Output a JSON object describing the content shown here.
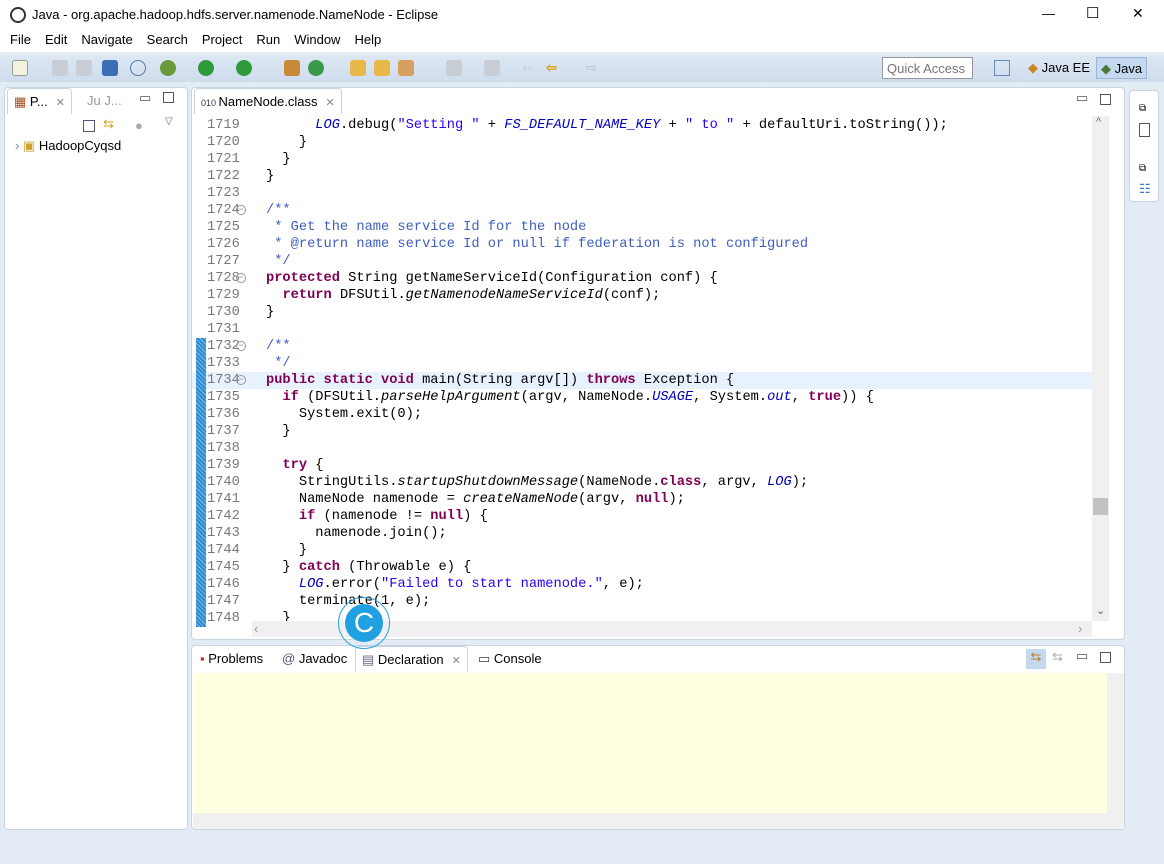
{
  "window": {
    "title": "Java - org.apache.hadoop.hdfs.server.namenode.NameNode - Eclipse",
    "minimize": "—",
    "maximize": "☐",
    "close": "✕"
  },
  "menu": [
    "File",
    "Edit",
    "Navigate",
    "Search",
    "Project",
    "Run",
    "Window",
    "Help"
  ],
  "toolbar": {
    "quick_access_placeholder": "Quick Access",
    "perspectives": [
      {
        "label": "Java EE"
      },
      {
        "label": "Java",
        "active": true
      }
    ]
  },
  "left_panel": {
    "tabs": [
      {
        "label": "P...",
        "active": true
      },
      {
        "label": "J..."
      }
    ],
    "tree": [
      {
        "label": "HadoopCyqsd"
      }
    ]
  },
  "editor": {
    "tab": "NameNode.class",
    "current_line": 1734,
    "lines": [
      {
        "n": "1719",
        "t": [
          [
            "p",
            "      "
          ],
          [
            "sf",
            "LOG"
          ],
          [
            "p",
            ".debug("
          ],
          [
            "s",
            "\"Setting \""
          ],
          [
            "p",
            " + "
          ],
          [
            "sf",
            "FS_DEFAULT_NAME_KEY"
          ],
          [
            "p",
            " + "
          ],
          [
            "s",
            "\" to \""
          ],
          [
            "p",
            " + defaultUri.toString());"
          ]
        ]
      },
      {
        "n": "1720",
        "t": [
          [
            "p",
            "    }"
          ]
        ]
      },
      {
        "n": "1721",
        "t": [
          [
            "p",
            "  }"
          ]
        ]
      },
      {
        "n": "1722",
        "t": [
          [
            "p",
            "}"
          ]
        ]
      },
      {
        "n": "1723",
        "t": []
      },
      {
        "n": "1724",
        "fold": true,
        "t": [
          [
            "d",
            "/**"
          ]
        ]
      },
      {
        "n": "1725",
        "t": [
          [
            "d",
            " * Get the name service Id for the node"
          ]
        ]
      },
      {
        "n": "1726",
        "t": [
          [
            "d",
            " * @return name service Id or null if federation is not configured"
          ]
        ]
      },
      {
        "n": "1727",
        "t": [
          [
            "d",
            " */"
          ]
        ]
      },
      {
        "n": "1728",
        "fold": true,
        "t": [
          [
            "k",
            "protected"
          ],
          [
            "p",
            " String getNameServiceId(Configuration conf) {"
          ]
        ]
      },
      {
        "n": "1729",
        "t": [
          [
            "p",
            "  "
          ],
          [
            "k",
            "return"
          ],
          [
            "p",
            " DFSUtil."
          ],
          [
            "i",
            "getNamenodeNameServiceId"
          ],
          [
            "p",
            "(conf);"
          ]
        ]
      },
      {
        "n": "1730",
        "t": [
          [
            "p",
            "}"
          ]
        ]
      },
      {
        "n": "1731",
        "t": []
      },
      {
        "n": "1732",
        "fold": true,
        "mark": true,
        "t": [
          [
            "d",
            "/**"
          ]
        ]
      },
      {
        "n": "1733",
        "mark": true,
        "t": [
          [
            "d",
            " */"
          ]
        ]
      },
      {
        "n": "1734",
        "fold": true,
        "mark": true,
        "t": [
          [
            "k",
            "public static void"
          ],
          [
            "p",
            " main(String argv[]) "
          ],
          [
            "k",
            "throws"
          ],
          [
            "p",
            " Exception {"
          ]
        ]
      },
      {
        "n": "1735",
        "mark": true,
        "t": [
          [
            "p",
            "  "
          ],
          [
            "k",
            "if"
          ],
          [
            "p",
            " (DFSUtil."
          ],
          [
            "i",
            "parseHelpArgument"
          ],
          [
            "p",
            "(argv, NameNode."
          ],
          [
            "sf",
            "USAGE"
          ],
          [
            "p",
            ", System."
          ],
          [
            "sf",
            "out"
          ],
          [
            "p",
            ", "
          ],
          [
            "k",
            "true"
          ],
          [
            "p",
            ")) {"
          ]
        ]
      },
      {
        "n": "1736",
        "mark": true,
        "t": [
          [
            "p",
            "    System.exit(0);"
          ]
        ]
      },
      {
        "n": "1737",
        "mark": true,
        "t": [
          [
            "p",
            "  }"
          ]
        ]
      },
      {
        "n": "1738",
        "mark": true,
        "t": []
      },
      {
        "n": "1739",
        "mark": true,
        "t": [
          [
            "p",
            "  "
          ],
          [
            "k",
            "try"
          ],
          [
            "p",
            " {"
          ]
        ]
      },
      {
        "n": "1740",
        "mark": true,
        "t": [
          [
            "p",
            "    StringUtils."
          ],
          [
            "i",
            "startupShutdownMessage"
          ],
          [
            "p",
            "(NameNode."
          ],
          [
            "k",
            "class"
          ],
          [
            "p",
            ", argv, "
          ],
          [
            "sf",
            "LOG"
          ],
          [
            "p",
            ");"
          ]
        ]
      },
      {
        "n": "1741",
        "mark": true,
        "t": [
          [
            "p",
            "    NameNode namenode = "
          ],
          [
            "i",
            "createNameNode"
          ],
          [
            "p",
            "(argv, "
          ],
          [
            "k",
            "null"
          ],
          [
            "p",
            ");"
          ]
        ]
      },
      {
        "n": "1742",
        "mark": true,
        "t": [
          [
            "p",
            "    "
          ],
          [
            "k",
            "if"
          ],
          [
            "p",
            " (namenode != "
          ],
          [
            "k",
            "null"
          ],
          [
            "p",
            ") {"
          ]
        ]
      },
      {
        "n": "1743",
        "mark": true,
        "t": [
          [
            "p",
            "      namenode.join();"
          ]
        ]
      },
      {
        "n": "1744",
        "mark": true,
        "t": [
          [
            "p",
            "    }"
          ]
        ]
      },
      {
        "n": "1745",
        "mark": true,
        "t": [
          [
            "p",
            "  } "
          ],
          [
            "k",
            "catch"
          ],
          [
            "p",
            " (Throwable e) {"
          ]
        ]
      },
      {
        "n": "1746",
        "mark": true,
        "t": [
          [
            "p",
            "    "
          ],
          [
            "sf",
            "LOG"
          ],
          [
            "p",
            ".error("
          ],
          [
            "s",
            "\"Failed to start namenode.\""
          ],
          [
            "p",
            ", e);"
          ]
        ]
      },
      {
        "n": "1747",
        "mark": true,
        "t": [
          [
            "p",
            "    terminate(1, e);"
          ]
        ]
      },
      {
        "n": "1748",
        "mark": true,
        "t": [
          [
            "p",
            "  }"
          ]
        ]
      }
    ]
  },
  "bottom_panel": {
    "tabs": [
      {
        "label": "Problems"
      },
      {
        "label": "Javadoc"
      },
      {
        "label": "Declaration",
        "active": true
      },
      {
        "label": "Console"
      }
    ]
  },
  "overlay": {
    "badge": "C"
  },
  "colors": {
    "keyword": "#7f0055",
    "string": "#2a00ff",
    "static_field": "#0000c0",
    "javadoc": "#3f5fbf",
    "declaration_bg": "#ffffe1",
    "accent": "#1fa0e0"
  }
}
